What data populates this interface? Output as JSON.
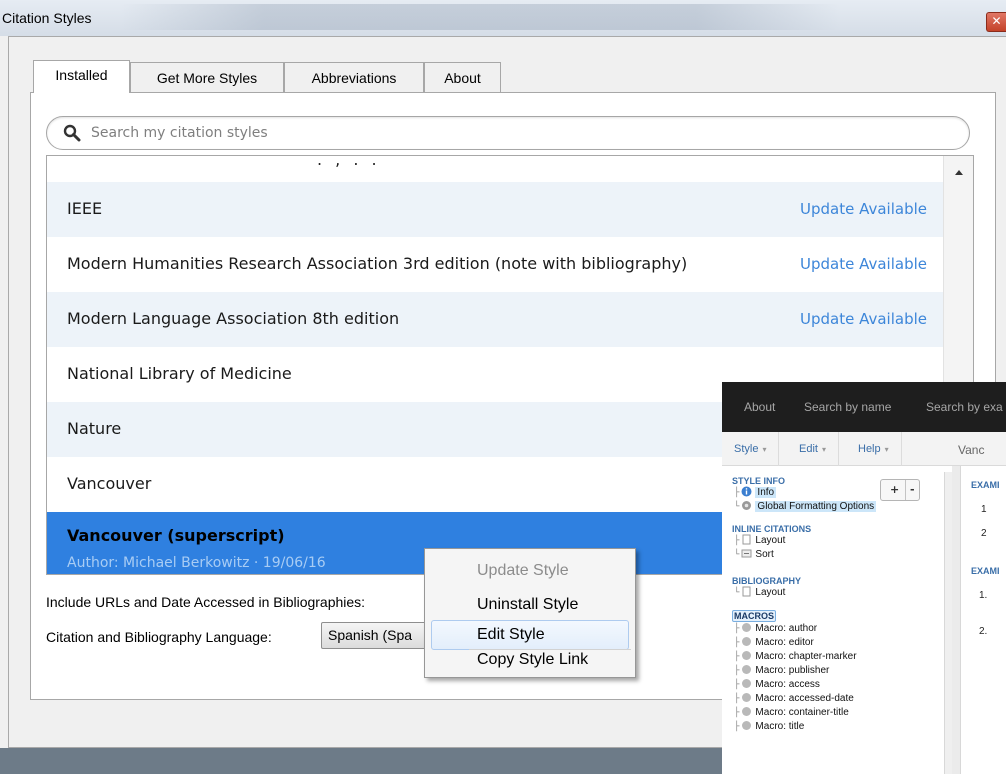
{
  "window": {
    "title": "Citation Styles",
    "close_glyph": "✕"
  },
  "tabs": [
    {
      "label": "Installed",
      "selected": true
    },
    {
      "label": "Get More Styles"
    },
    {
      "label": "Abbreviations"
    },
    {
      "label": "About"
    }
  ],
  "search": {
    "placeholder": "Search my citation styles",
    "icon": "search-icon"
  },
  "styles_list": {
    "partial_row_text": ". , . .",
    "rows": [
      {
        "name": "IEEE",
        "status": "Update Available"
      },
      {
        "name": "Modern Humanities Research Association 3rd edition (note with bibliography)",
        "status": "Update Available"
      },
      {
        "name": "Modern Language Association 8th edition",
        "status": "Update Available"
      },
      {
        "name": "National Library of Medicine",
        "status": ""
      },
      {
        "name": "Nature",
        "status": ""
      },
      {
        "name": "Vancouver",
        "status": ""
      },
      {
        "name": "Vancouver (superscript)",
        "meta": "Author: Michael Berkowitz · 19/06/16",
        "selected": true
      }
    ]
  },
  "options": {
    "urls_label": "Include URLs and Date Accessed in Bibliographies:",
    "language_label": "Citation and Bibliography Language:",
    "language_value": "Spanish (Spa"
  },
  "context_menu": {
    "items": [
      {
        "label": "Update Style",
        "disabled": true
      },
      {
        "label": "Uninstall Style"
      },
      {
        "label": "Edit Style",
        "highlighted": true
      },
      {
        "label": "Copy Style Link"
      }
    ]
  },
  "editor": {
    "nav": [
      "About",
      "Search by name",
      "Search by exa"
    ],
    "menus": [
      "Style",
      "Edit",
      "Help"
    ],
    "doc_title": "Vanc",
    "plus": "+",
    "minus": "-",
    "sections": {
      "style_info": "STYLE INFO",
      "inline_citations": "INLINE CITATIONS",
      "bibliography": "BIBLIOGRAPHY",
      "macros": "MACROS"
    },
    "style_info_nodes": [
      "Info",
      "Global Formatting Options"
    ],
    "inline_nodes": [
      "Layout",
      "Sort"
    ],
    "bibliography_nodes": [
      "Layout"
    ],
    "macro_nodes": [
      "Macro: author",
      "Macro: editor",
      "Macro: chapter-marker",
      "Macro: publisher",
      "Macro: access",
      "Macro: accessed-date",
      "Macro: container-title",
      "Macro: title"
    ],
    "example_labels": [
      "EXAMI",
      "EXAMI"
    ],
    "example_numbers_1": [
      "1",
      "2"
    ],
    "example_numbers_2": [
      "1.",
      "2."
    ]
  },
  "colors": {
    "selection": "#2f80e0",
    "update_link": "#3d86d9",
    "alt_row": "#edf3f9",
    "editor_nav": "#1e1e1e"
  }
}
